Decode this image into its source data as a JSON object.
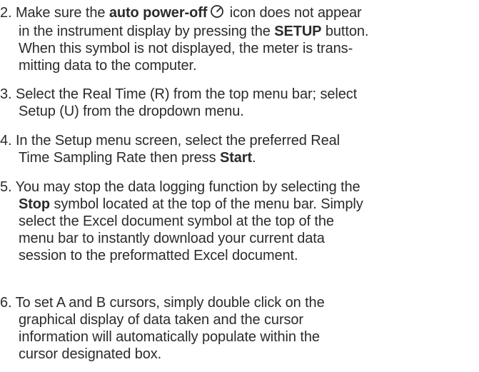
{
  "steps": [
    {
      "number": "2.",
      "lines": [
        [
          "Make sure the ",
          "auto power-off",
          " icon does not appear"
        ],
        [
          "in the instrument display by pressing the ",
          "SETUP",
          " button."
        ],
        [
          "When this symbol is not displayed, the meter is trans-"
        ],
        [
          "mitting data to the computer."
        ]
      ]
    },
    {
      "number": "3.",
      "lines": [
        [
          "Select the Real Time (R) from the top menu bar; select"
        ],
        [
          "Setup (U) from the dropdown menu."
        ]
      ]
    },
    {
      "number": "4.",
      "lines": [
        [
          "In the Setup menu screen, select the preferred Real"
        ],
        [
          "Time Sampling Rate then press ",
          "Start",
          "."
        ]
      ]
    },
    {
      "number": "5.",
      "lines": [
        [
          "You may stop the data logging function by selecting the"
        ],
        [
          "Stop",
          " symbol located at the top of the menu bar. Simply"
        ],
        [
          "select the Excel document symbol at the top of the"
        ],
        [
          "menu bar to instantly download your current data"
        ],
        [
          "session to the preformatted Excel document."
        ]
      ]
    },
    {
      "number": "6.",
      "lines": [
        [
          "To set A and B cursors, simply double click on the"
        ],
        [
          "graphical display of data taken and the cursor"
        ],
        [
          "information will automatically populate within the"
        ],
        [
          "cursor designated box."
        ]
      ]
    }
  ],
  "icons": {
    "auto_power_off": "timer-clock-icon"
  }
}
